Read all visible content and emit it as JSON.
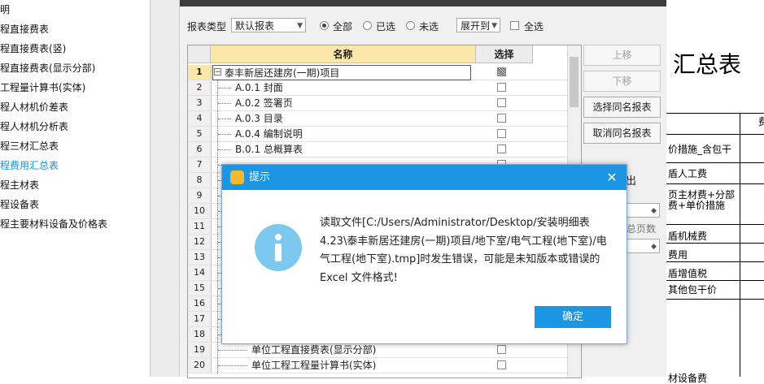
{
  "left_tree": {
    "items": [
      {
        "label": "明",
        "active": false
      },
      {
        "label": "程直接费表",
        "active": false
      },
      {
        "label": "程直接费表(竖)",
        "active": false
      },
      {
        "label": "程直接费表(显示分部)",
        "active": false
      },
      {
        "label": "工程量计算书(实体)",
        "active": false
      },
      {
        "label": "程人材机价差表",
        "active": false
      },
      {
        "label": "程人材机分析表",
        "active": false
      },
      {
        "label": "程三材汇总表",
        "active": false
      },
      {
        "label": "程费用汇总表",
        "active": true
      },
      {
        "label": "程主材表",
        "active": false
      },
      {
        "label": "程设备表",
        "active": false
      },
      {
        "label": "程主要材料设备及价格表",
        "active": false
      }
    ]
  },
  "dialog": {
    "report_type_label": "报表类型",
    "report_type_value": "默认报表",
    "radio_all": "全部",
    "radio_selected": "已选",
    "radio_unselected": "未选",
    "expand_combo": "展开到",
    "select_all_label": "全选",
    "grid": {
      "col_name": "名称",
      "col_select": "选择",
      "rows": [
        {
          "n": "1",
          "name": "泰丰新居还建房(一期)项目",
          "level": 0
        },
        {
          "n": "2",
          "name": "A.0.1 封面",
          "level": 1
        },
        {
          "n": "3",
          "name": "A.0.2 签署页",
          "level": 1
        },
        {
          "n": "4",
          "name": "A.0.3 目录",
          "level": 1
        },
        {
          "n": "5",
          "name": "A.0.4 编制说明",
          "level": 1
        },
        {
          "n": "6",
          "name": "B.0.1 总概算表",
          "level": 1
        },
        {
          "n": "7",
          "name": "",
          "level": 1
        },
        {
          "n": "8",
          "name": "",
          "level": 1
        },
        {
          "n": "9",
          "name": "",
          "level": 1
        },
        {
          "n": "10",
          "name": "",
          "level": 1
        },
        {
          "n": "11",
          "name": "",
          "level": 1
        },
        {
          "n": "12",
          "name": "",
          "level": 1
        },
        {
          "n": "13",
          "name": "",
          "level": 1
        },
        {
          "n": "14",
          "name": "",
          "level": 1
        },
        {
          "n": "15",
          "name": "",
          "level": 1
        },
        {
          "n": "16",
          "name": "",
          "level": 1
        },
        {
          "n": "17",
          "name": "",
          "level": 1
        },
        {
          "n": "18",
          "name": "",
          "level": 1
        },
        {
          "n": "19",
          "name": "单位工程直接费表(显示分部)",
          "level": 2
        },
        {
          "n": "20",
          "name": "单位工程工程量计算书(实体)",
          "level": 2
        }
      ]
    },
    "buttons": {
      "move_up": "上移",
      "move_down": "下移",
      "select_same": "选择同名报表",
      "cancel_same": "取消同名报表"
    },
    "partial_output_label": "出",
    "partial_total_pages": "总页数"
  },
  "document": {
    "title": "汇总表",
    "partial_header": "费",
    "rows": [
      "价措施_含包干",
      "盾人工费",
      "页主材费+分部",
      "费+单价措施",
      "盾机械费",
      "费用",
      "盾增值税",
      "其他包干价",
      "材设备费"
    ]
  },
  "modal": {
    "title": "提示",
    "close": "✕",
    "message": "读取文件[C:/Users/Administrator/Desktop/安装明细表4.23\\泰丰新居还建房(一期)项目/地下室/电气工程(地下室)/电气工程(地下室).tmp]时发生错误，可能是未知版本或错误的 Excel 文件格式!",
    "ok": "确定"
  }
}
